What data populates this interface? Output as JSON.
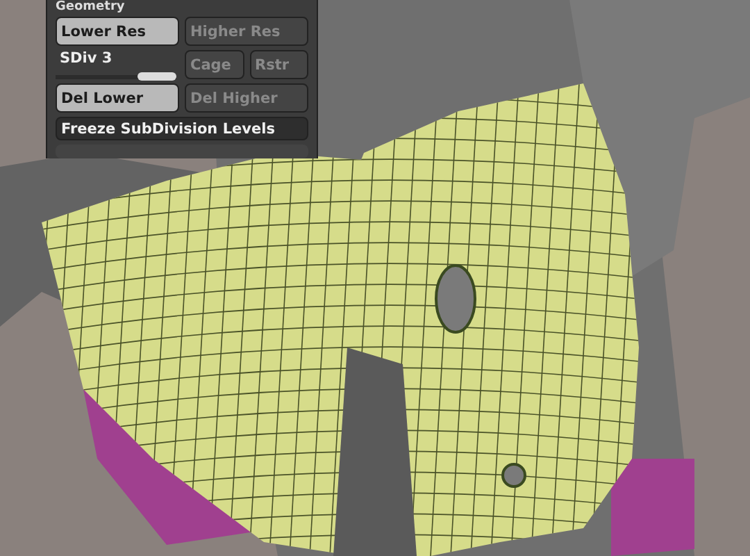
{
  "geometry_panel": {
    "title": "Geometry",
    "lower_res": {
      "label": "Lower Res",
      "disabled": false
    },
    "higher_res": {
      "label": "Higher Res",
      "disabled": true
    },
    "sdiv": {
      "label": "SDiv 3",
      "level": 1
    },
    "cage": {
      "label": "Cage",
      "disabled": true
    },
    "rstr": {
      "label": "Rstr",
      "disabled": true
    },
    "del_lower": {
      "label": "Del Lower",
      "disabled": false
    },
    "del_higher": {
      "label": "Del Higher",
      "disabled": true
    },
    "freeze": {
      "label": "Freeze SubDivision Levels",
      "disabled": false
    }
  }
}
